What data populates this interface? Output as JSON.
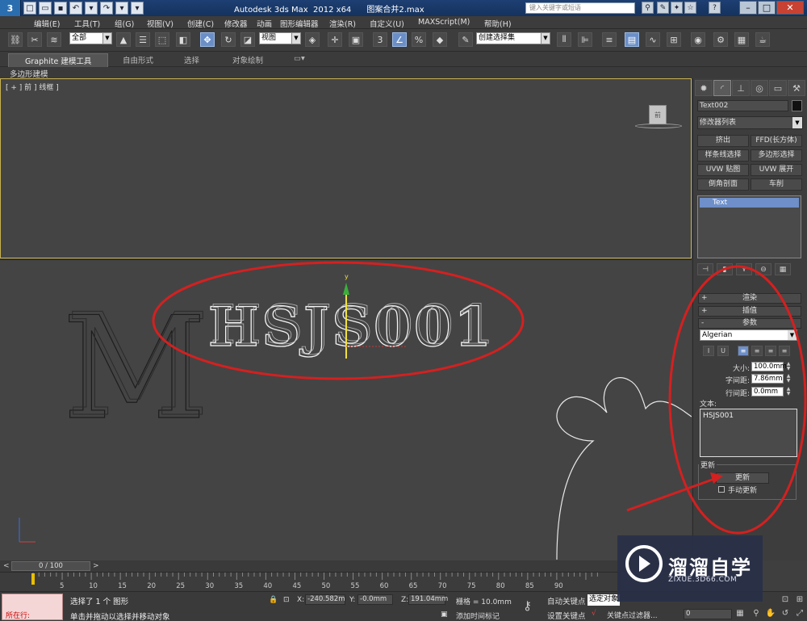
{
  "titlebar": {
    "logo": "3",
    "title": "Autodesk 3ds Max  2012 x64      图案合并2.max",
    "search_placeholder": "键入关键字或短语"
  },
  "menubar": {
    "items": [
      "编辑(E)",
      "工具(T)",
      "组(G)",
      "视图(V)",
      "创建(C)",
      "修改器",
      "动画",
      "图形编辑器",
      "渲染(R)",
      "自定义(U)",
      "MAXScript(M)",
      "帮助(H)"
    ]
  },
  "toolbar": {
    "filter_value": "全部",
    "refcoord_value": "视图",
    "namedsel_value": "创建选择集",
    "snap_label": "3",
    "percent_label": "%"
  },
  "ribbon": {
    "tabs": [
      "Graphite 建模工具",
      "自由形式",
      "选择",
      "对象绘制"
    ],
    "sub_label": "多边形建模"
  },
  "viewport": {
    "label": "[ + ] 前 ] 线框 ]",
    "viewcube_label": "前",
    "text_object": "HSJS001",
    "background_text": "M",
    "axis_y": "y"
  },
  "command_panel": {
    "object_name": "Text002",
    "object_color": "#111111",
    "modifier_list_label": "修改器列表",
    "modifier_buttons": [
      "挤出",
      "FFD(长方体)",
      "样条线选择",
      "多边形选择",
      "UVW 贴图",
      "UVW 展开",
      "倒角剖面",
      "车削"
    ],
    "stack_item": "Text",
    "rollouts": [
      {
        "sign": "+",
        "label": "渲染"
      },
      {
        "sign": "+",
        "label": "插值"
      },
      {
        "sign": "-",
        "label": "参数"
      }
    ],
    "font": "Algerian",
    "style_buttons": [
      "I",
      "U"
    ],
    "params": [
      {
        "label": "大小:",
        "value": "100.0mm"
      },
      {
        "label": "字间距:",
        "value": "7.86mm"
      },
      {
        "label": "行间距:",
        "value": "0.0mm"
      }
    ],
    "text_label": "文本:",
    "text_value": "HSJS001",
    "update_group_label": "更新",
    "update_button": "更新",
    "manual_update_label": "手动更新"
  },
  "timeline": {
    "frame_display": "0 / 100",
    "ticks": [
      "5",
      "10",
      "15",
      "20",
      "25",
      "30",
      "35",
      "40",
      "45",
      "50",
      "55",
      "60",
      "65",
      "70",
      "75",
      "80",
      "85",
      "90"
    ]
  },
  "statusbar": {
    "running_label": "所在行:",
    "selection_text": "选择了 1 个 图形",
    "prompt_text": "单击并拖动以选择并移动对象",
    "x_label": "X:",
    "x_value": "-240.582m",
    "y_label": "Y:",
    "y_value": "-0.0mm",
    "z_label": "Z:",
    "z_value": "191.04mm",
    "grid_text": "栅格 = 10.0mm",
    "add_tag_text": "添加时间标记",
    "auto_key_label": "自动关键点",
    "set_key_label": "设置关键点",
    "selection_set_value": "选定对象",
    "key_filter_label": "关键点过滤器...",
    "frame_value": "0"
  },
  "watermark": {
    "title": "溜溜自学",
    "subtitle": "ZIXUE.3D66.COM"
  },
  "colors": {
    "annotation_red": "#d42020",
    "selection_blue": "#6e8fc9",
    "viewport_bg": "#444444"
  }
}
